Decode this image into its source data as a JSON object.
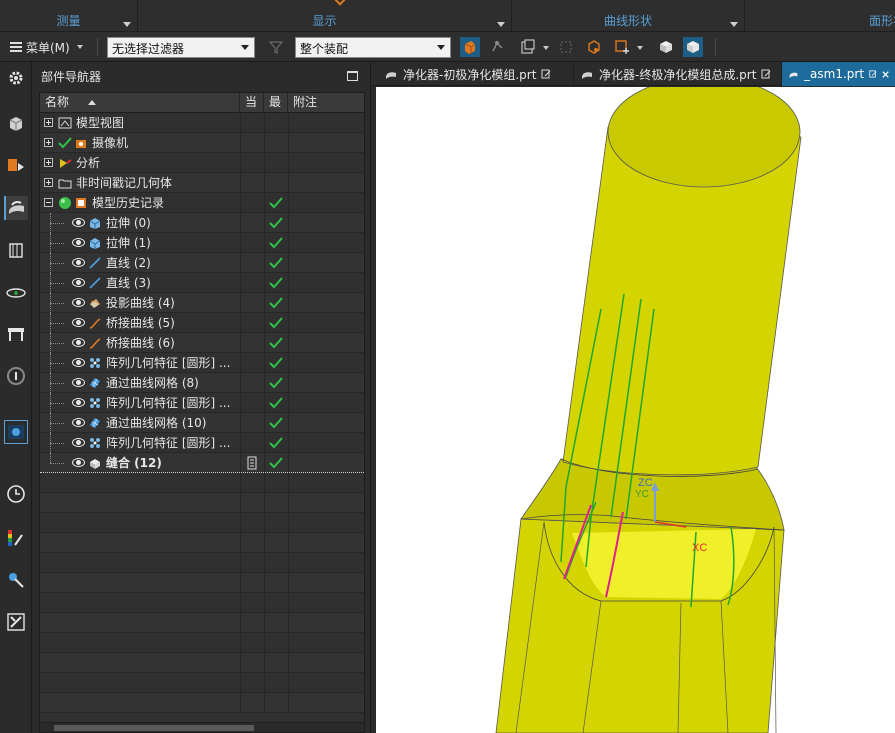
{
  "ribbon": {
    "groups": [
      {
        "label": "测量"
      },
      {
        "label": "显示"
      },
      {
        "label": "曲线形状"
      },
      {
        "label": "面形状"
      }
    ]
  },
  "toolbar": {
    "menu_label": "菜单(M)",
    "filter_value": "无选择过滤器",
    "assembly_value": "整个装配"
  },
  "navigator": {
    "title": "部件导航器",
    "columns": [
      "名称",
      "当",
      "最",
      "附注"
    ],
    "rows": [
      {
        "label": "模型视图",
        "depth": 0,
        "expander": "plus",
        "icon": "model-views-icon",
        "eye": false,
        "check": false
      },
      {
        "label": "摄像机",
        "depth": 0,
        "expander": "plus",
        "icon": "camera-icon",
        "eye": false,
        "check": false
      },
      {
        "label": "分析",
        "depth": 0,
        "expander": "plus",
        "icon": "analysis-icon",
        "eye": false,
        "check": false
      },
      {
        "label": "非时间戳记几何体",
        "depth": 0,
        "expander": "plus",
        "icon": "folder-icon",
        "eye": false,
        "check": false
      },
      {
        "label": "模型历史记录",
        "depth": 0,
        "expander": "minus",
        "icon": "model-history-icon",
        "eye": false,
        "check": true
      },
      {
        "label": "拉伸 (0)",
        "depth": 1,
        "icon": "extrude-icon",
        "eye": true,
        "check": true
      },
      {
        "label": "拉伸 (1)",
        "depth": 1,
        "icon": "extrude-icon",
        "eye": true,
        "check": true
      },
      {
        "label": "直线 (2)",
        "depth": 1,
        "icon": "line-icon",
        "eye": true,
        "check": true
      },
      {
        "label": "直线 (3)",
        "depth": 1,
        "icon": "line-icon",
        "eye": true,
        "check": true
      },
      {
        "label": "投影曲线 (4)",
        "depth": 1,
        "icon": "projected-curve-icon",
        "eye": true,
        "check": true
      },
      {
        "label": "桥接曲线 (5)",
        "depth": 1,
        "icon": "bridge-curve-icon",
        "eye": true,
        "check": true
      },
      {
        "label": "桥接曲线 (6)",
        "depth": 1,
        "icon": "bridge-curve-icon",
        "eye": true,
        "check": true
      },
      {
        "label": "阵列几何特征 [圆形] ...",
        "depth": 1,
        "icon": "pattern-geometry-icon",
        "eye": true,
        "check": true
      },
      {
        "label": "通过曲线网格 (8)",
        "depth": 1,
        "icon": "curve-mesh-icon",
        "eye": true,
        "check": true
      },
      {
        "label": "阵列几何特征 [圆形] ...",
        "depth": 1,
        "icon": "pattern-geometry-icon",
        "eye": true,
        "check": true
      },
      {
        "label": "通过曲线网格 (10)",
        "depth": 1,
        "icon": "curve-mesh-icon",
        "eye": true,
        "check": true
      },
      {
        "label": "阵列几何特征 [圆形] ...",
        "depth": 1,
        "icon": "pattern-geometry-icon",
        "eye": true,
        "check": true
      },
      {
        "label": "缝合 (12)",
        "depth": 1,
        "icon": "sew-icon",
        "eye": true,
        "check": true,
        "bold": true,
        "current": true
      }
    ]
  },
  "tabs": [
    {
      "label": "净化器-初极净化模组.prt"
    },
    {
      "label": "净化器-终极净化模组总成.prt"
    },
    {
      "label": "_asm1.prt",
      "active": true
    }
  ],
  "viewport": {
    "axis_labels": {
      "zc": "ZC",
      "yc": "YC",
      "xc": "XC"
    },
    "colors": {
      "body": "#d4d400",
      "body_dark": "#a8a800",
      "curve_green": "#1fa82a",
      "curve_magenta": "#e0208c",
      "xc_color": "#e03030"
    }
  }
}
